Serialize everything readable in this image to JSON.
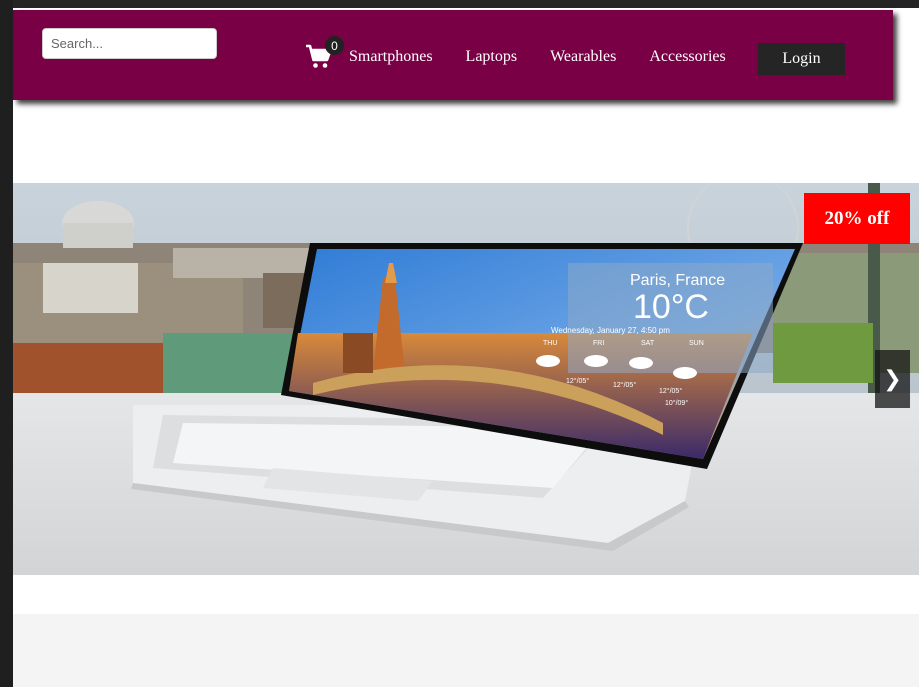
{
  "search": {
    "placeholder": "Search...",
    "value": ""
  },
  "cart": {
    "icon": "shopping-cart-icon",
    "count": "0"
  },
  "nav": {
    "items": [
      {
        "label": "Smartphones"
      },
      {
        "label": "Laptops"
      },
      {
        "label": "Wearables"
      },
      {
        "label": "Accessories"
      }
    ],
    "login_label": "Login"
  },
  "hero": {
    "discount": "20% off",
    "next_arrow": "❯",
    "screen": {
      "city": "Paris, France",
      "temperature": "10°C",
      "date": "Wednesday, January 27, 4:50 pm",
      "days": [
        "THU",
        "FRI",
        "SAT",
        "SUN"
      ],
      "temps": [
        "12°/05°",
        "12°/05°",
        "12°/05°",
        "10°/09°"
      ]
    }
  },
  "colors": {
    "navbar": "#7a0046",
    "login_bg": "#252525",
    "discount_bg": "#ff0000"
  }
}
